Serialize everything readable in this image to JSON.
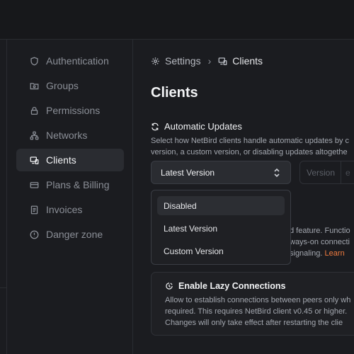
{
  "sidebar": {
    "items": [
      {
        "label": "Authentication",
        "icon": "shield-icon"
      },
      {
        "label": "Groups",
        "icon": "groups-icon"
      },
      {
        "label": "Permissions",
        "icon": "lock-icon"
      },
      {
        "label": "Networks",
        "icon": "network-icon"
      },
      {
        "label": "Clients",
        "icon": "devices-icon",
        "active": true
      },
      {
        "label": "Plans & Billing",
        "icon": "credit-card-icon"
      },
      {
        "label": "Invoices",
        "icon": "document-icon"
      },
      {
        "label": "Danger zone",
        "icon": "alert-icon"
      }
    ]
  },
  "breadcrumb": {
    "root": "Settings",
    "separator": "›",
    "current": "Clients"
  },
  "page": {
    "title": "Clients"
  },
  "updates": {
    "title": "Automatic Updates",
    "description_line1": "Select how NetBird clients handle automatic updates by c",
    "description_line2": "version, a custom version, or disabling updates altogethe",
    "selected": "Latest Version",
    "version_placeholder": "Version",
    "version_suffix": "e",
    "options": [
      "Disabled",
      "Latest Version",
      "Custom Version"
    ],
    "highlighted_option": "Disabled"
  },
  "background_text": {
    "line1": "d feature. Functio",
    "line2": "ways-on connecti",
    "line3": "signaling.",
    "learn": "Learn"
  },
  "lazy": {
    "title": "Enable Lazy Connections",
    "line1": "Allow to establish connections between peers only wh",
    "line2": "required. This requires NetBird client v0.45 or higher.",
    "line3": "Changes will only take effect after restarting the clie"
  },
  "colors": {
    "background": "#1b1c20",
    "accent_link": "#f07b3f",
    "active_nav": "#2a2c31"
  }
}
